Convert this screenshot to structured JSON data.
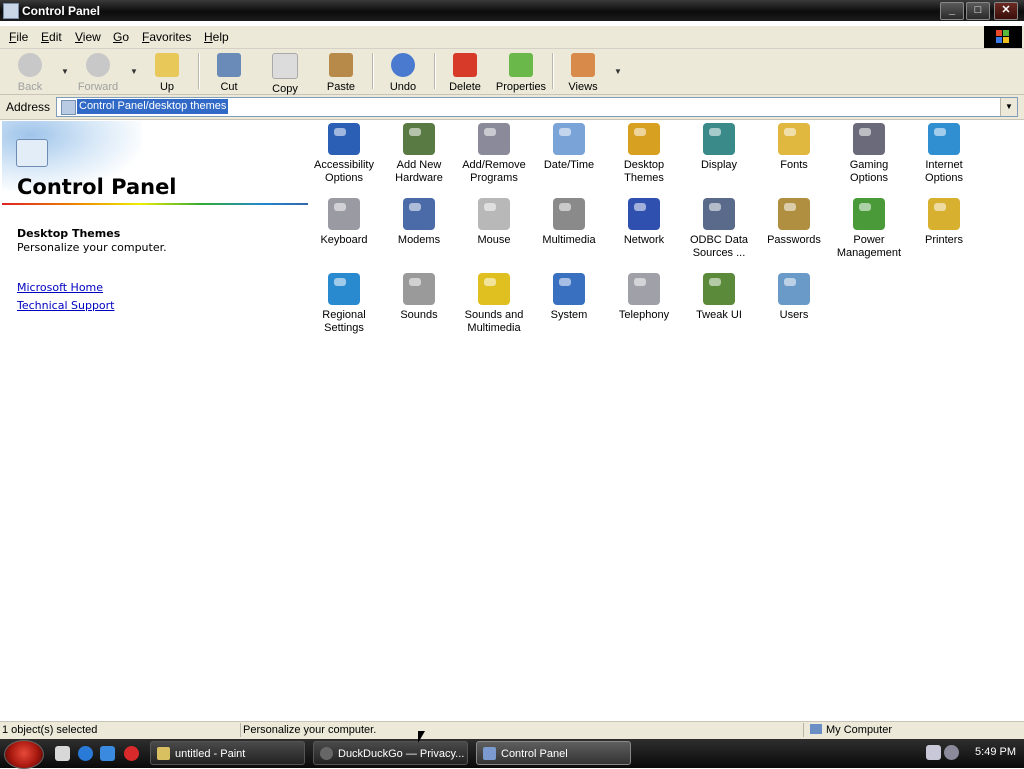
{
  "window": {
    "title": "Control Panel",
    "buttons": {
      "minimize": "_",
      "maximize": "□",
      "close": "✕"
    }
  },
  "menu": [
    "File",
    "Edit",
    "View",
    "Go",
    "Favorites",
    "Help"
  ],
  "toolbar": {
    "back": "Back",
    "forward": "Forward",
    "up": "Up",
    "cut": "Cut",
    "copy": "Copy",
    "paste": "Paste",
    "undo": "Undo",
    "delete": "Delete",
    "properties": "Properties",
    "views": "Views"
  },
  "address": {
    "label": "Address",
    "value": "Control Panel/desktop themes"
  },
  "left_panel": {
    "title": "Control Panel",
    "selected_name": "Desktop Themes",
    "selected_desc": "Personalize your computer.",
    "links": [
      "Microsoft Home",
      "Technical Support"
    ]
  },
  "items": [
    {
      "label": "Accessibility Options",
      "icon": "accessibility-icon",
      "color": "#2b5fb6"
    },
    {
      "label": "Add New Hardware",
      "icon": "add-hardware-icon",
      "color": "#5a7a44"
    },
    {
      "label": "Add/Remove Programs",
      "icon": "add-remove-programs-icon",
      "color": "#8a8a9a"
    },
    {
      "label": "Date/Time",
      "icon": "date-time-icon",
      "color": "#7aa4d8"
    },
    {
      "label": "Desktop Themes",
      "icon": "desktop-themes-icon",
      "color": "#d8a020"
    },
    {
      "label": "Display",
      "icon": "display-icon",
      "color": "#3a8a8a"
    },
    {
      "label": "Fonts",
      "icon": "fonts-icon",
      "color": "#e0b840"
    },
    {
      "label": "Gaming Options",
      "icon": "gaming-options-icon",
      "color": "#6a6a7a"
    },
    {
      "label": "Internet Options",
      "icon": "internet-options-icon",
      "color": "#2f8fd0"
    },
    {
      "label": "Keyboard",
      "icon": "keyboard-icon",
      "color": "#9a9aa2"
    },
    {
      "label": "Modems",
      "icon": "modems-icon",
      "color": "#4a6aa8"
    },
    {
      "label": "Mouse",
      "icon": "mouse-icon",
      "color": "#b8b8b8"
    },
    {
      "label": "Multimedia",
      "icon": "multimedia-icon",
      "color": "#8a8a8a"
    },
    {
      "label": "Network",
      "icon": "network-icon",
      "color": "#3050b0"
    },
    {
      "label": "ODBC Data Sources ...",
      "icon": "odbc-data-sources-icon",
      "color": "#5a6a8a"
    },
    {
      "label": "Passwords",
      "icon": "passwords-icon",
      "color": "#b09040"
    },
    {
      "label": "Power Management",
      "icon": "power-management-icon",
      "color": "#4a9a3a"
    },
    {
      "label": "Printers",
      "icon": "printers-icon",
      "color": "#d8b030"
    },
    {
      "label": "Regional Settings",
      "icon": "regional-settings-icon",
      "color": "#2a8ad0"
    },
    {
      "label": "Sounds",
      "icon": "sounds-icon",
      "color": "#9a9a9a"
    },
    {
      "label": "Sounds and Multimedia",
      "icon": "sounds-multimedia-icon",
      "color": "#e0c020"
    },
    {
      "label": "System",
      "icon": "system-icon",
      "color": "#3a70c0"
    },
    {
      "label": "Telephony",
      "icon": "telephony-icon",
      "color": "#a0a0a8"
    },
    {
      "label": "Tweak UI",
      "icon": "tweak-ui-icon",
      "color": "#5a8a3a"
    },
    {
      "label": "Users",
      "icon": "users-icon",
      "color": "#6a9ac8"
    }
  ],
  "status": {
    "selection": "1 object(s) selected",
    "description": "Personalize your computer.",
    "zone": "My Computer"
  },
  "taskbar": {
    "tasks": [
      {
        "label": "untitled - Paint",
        "icon": "paint-icon",
        "color": "#d8c060"
      },
      {
        "label": "DuckDuckGo — Privacy...",
        "icon": "browser-icon",
        "color": "#666666"
      },
      {
        "label": "Control Panel",
        "icon": "control-panel-icon",
        "color": "#7a9ad0"
      }
    ],
    "clock": "5:49 PM"
  }
}
